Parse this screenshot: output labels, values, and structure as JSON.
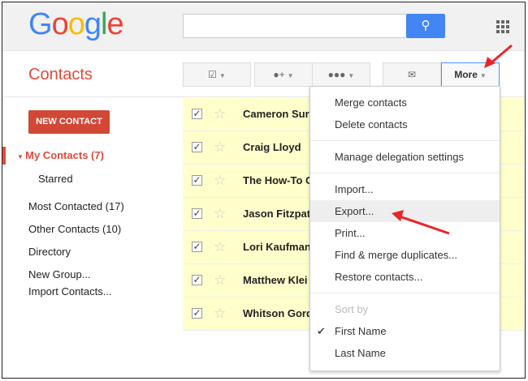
{
  "header": {
    "logo": "Google",
    "search_placeholder": "",
    "search_icon": "search-icon",
    "apps_icon": "apps-grid-icon"
  },
  "app_title": "Contacts",
  "toolbar": {
    "select_icon": "checkbox-icon",
    "add_person_icon": "add-person-icon",
    "groups_icon": "groups-icon",
    "email_icon": "envelope-icon",
    "more_label": "More"
  },
  "sidebar": {
    "new_contact": "NEW CONTACT",
    "my_contacts": "My Contacts (7)",
    "starred": "Starred",
    "most_contacted": "Most Contacted (17)",
    "other_contacts": "Other Contacts (10)",
    "directory": "Directory",
    "new_group": "New Group...",
    "import_contacts": "Import Contacts..."
  },
  "contacts": [
    "Cameron Sur",
    "Craig Lloyd",
    "The How-To G",
    "Jason Fitzpat",
    "Lori Kaufman",
    "Matthew Klei",
    "Whitson Gord"
  ],
  "menu": {
    "merge": "Merge contacts",
    "delete": "Delete contacts",
    "delegation": "Manage delegation settings",
    "import": "Import...",
    "export": "Export...",
    "print": "Print...",
    "find_merge": "Find & merge duplicates...",
    "restore": "Restore contacts...",
    "sort_by": "Sort by",
    "first_name": "First Name",
    "last_name": "Last Name"
  },
  "colors": {
    "accent": "#dd4b39",
    "search": "#4285f4",
    "row_selected": "#ffffcc",
    "annotation_arrow": "#e8262a"
  }
}
